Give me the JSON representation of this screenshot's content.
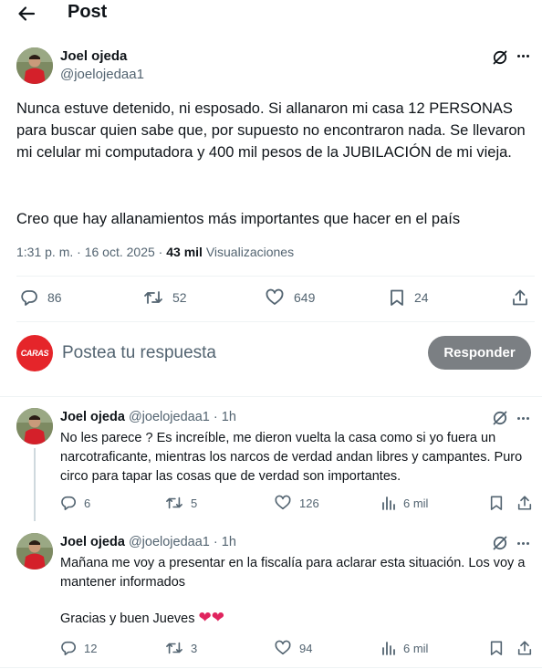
{
  "header": {
    "title": "Post"
  },
  "main_post": {
    "author_name": "Joel ojeda",
    "author_handle": "@joelojedaa1",
    "paragraph1": "Nunca estuve detenido, ni esposado. Si allanaron mi casa 12 PERSONAS para buscar quien sabe que, por supuesto no encontraron nada. Se llevaron mi celular mi computadora y 400 mil pesos de la JUBILACIÓN de mi vieja.",
    "paragraph2": "Creo que hay allanamientos más importantes que hacer en el país",
    "time": "1:31 p. m.",
    "separator": "·",
    "date": "16 oct. 2025",
    "views_count": "43 mil",
    "views_label": "Visualizaciones",
    "replies": "86",
    "reposts": "52",
    "likes": "649",
    "bookmarks": "24"
  },
  "composer": {
    "avatar_text": "CARAS",
    "placeholder": "Postea tu respuesta",
    "reply_button": "Responder"
  },
  "replies": [
    {
      "author_name": "Joel ojeda",
      "author_handle": "@joelojedaa1",
      "dot": "·",
      "time": "1h",
      "text": "No les parece ? Es increíble, me dieron vuelta la casa como si yo fuera un narcotraficante, mientras los narcos de verdad andan libres y campantes. Puro circo para tapar las cosas que de verdad son importantes.",
      "replies": "6",
      "reposts": "5",
      "likes": "126",
      "views": "6 mil"
    },
    {
      "author_name": "Joel ojeda",
      "author_handle": "@joelojedaa1",
      "dot": "·",
      "time": "1h",
      "text_line1": "Mañana me voy a presentar en la fiscalía para aclarar esta situación. Los voy a mantener informados",
      "text_line2": "Gracias y buen Jueves",
      "emoji": "❤❤",
      "replies": "12",
      "reposts": "3",
      "likes": "94",
      "views": "6 mil"
    }
  ],
  "colors": {
    "text": "#0f1419",
    "secondary": "#536471",
    "divider": "#eff3f4",
    "reply_button_bg": "#7b7f83",
    "caras_red": "#e5252a",
    "heart": "#e0245e"
  }
}
